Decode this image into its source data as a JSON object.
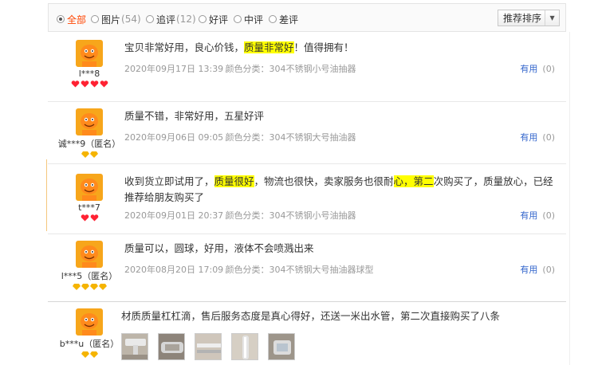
{
  "filters": [
    {
      "label": "全部",
      "count": "",
      "checked": true
    },
    {
      "label": "图片",
      "count": "(54)",
      "checked": false
    },
    {
      "label": "追评",
      "count": "(12)",
      "checked": false
    },
    {
      "label": "好评",
      "count": "",
      "checked": false
    },
    {
      "label": "中评",
      "count": "",
      "checked": false
    },
    {
      "label": "差评",
      "count": "",
      "checked": false
    }
  ],
  "sort": {
    "label": "推荐排序",
    "arrow": "▼"
  },
  "useful_label": "有用",
  "reviews": [
    {
      "user": "l***8",
      "badge": "red-hearts",
      "badge_count": 4,
      "text_parts": [
        "宝贝非常好用，良心价钱，",
        "质量非常好",
        "！值得拥有！"
      ],
      "date": "2020年09月17日 13:39",
      "variant": "颜色分类：304不锈钢小号油抽器",
      "useful_count": "(0)"
    },
    {
      "user": "诚***9（匿名）",
      "badge": "yellow-diamonds",
      "badge_count": 2,
      "text_parts": [
        "质量不错，非常好用，五星好评"
      ],
      "date": "2020年09月06日 09:05",
      "variant": "颜色分类：304不锈钢大号抽油器",
      "useful_count": "(0)"
    },
    {
      "user": "t***7",
      "badge": "red-hearts",
      "badge_count": 2,
      "text_parts": [
        "收到货立即试用了，",
        "质量很好",
        "，物流也很快，卖家服务也很耐",
        "心，第二",
        "次购买了，质量放心，已经推荐给朋友购买了"
      ],
      "date": "2020年09月01日 20:37",
      "variant": "颜色分类：304不锈钢小号油抽器",
      "useful_count": "(0)"
    },
    {
      "user": "l***5（匿名）",
      "badge": "yellow-diamonds",
      "badge_count": 4,
      "text_parts": [
        "质量可以，圆球，好用，液体不会喷溅出来"
      ],
      "date": "2020年08月20日 17:09",
      "variant": "颜色分类：304不锈钢大号抽油器球型",
      "useful_count": "(0)"
    },
    {
      "user": "b***u（匿名）",
      "badge": "yellow-diamonds",
      "badge_count": 2,
      "text_parts": [
        "材质质量杠杠滴，售后服务态度是真心得好，还送一米出水管，第二次直接购买了八条"
      ],
      "thumb_count": 5
    }
  ]
}
